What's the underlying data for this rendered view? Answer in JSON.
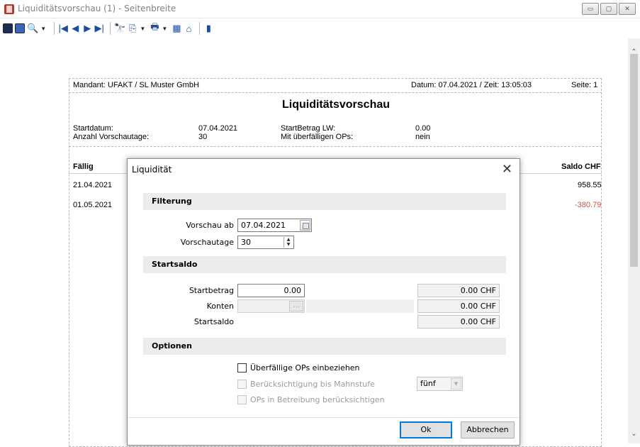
{
  "window": {
    "title": "Liquiditätsvorschau (1) - Seitenbreite",
    "minimize": "▭",
    "maximize": "▢",
    "close": "✕"
  },
  "toolbar": {
    "search_icon": "🔍",
    "dropdown_arrow": "▼",
    "first_page": "|◀",
    "prev_page": "◀",
    "next_page": "▶",
    "last_page": "▶|",
    "binoculars": "🔭",
    "export": "⎘",
    "print": "🖶",
    "excel": "▦",
    "settings": "⌂",
    "book": "▮"
  },
  "report": {
    "mandant": "Mandant: UFAKT / SL Muster GmbH",
    "datetime": "Datum: 07.04.2021 / Zeit: 13:05:03",
    "page": "Seite: 1",
    "title": "Liquiditätsvorschau",
    "startdatum_label": "Startdatum:",
    "startdatum_value": "07.04.2021",
    "vorschautage_label": "Anzahl Vorschautage:",
    "vorschautage_value": "30",
    "startbetrag_label": "StartBetrag LW:",
    "startbetrag_value": "0.00",
    "ueberfaellig_label": "Mit überfälligen OPs:",
    "ueberfaellig_value": "nein",
    "col_faellig": "Fällig",
    "col_saldo": "Saldo CHF",
    "rows": [
      {
        "date": "21.04.2021",
        "saldo": "958.55"
      },
      {
        "date": "01.05.2021",
        "saldo": "-380.79"
      }
    ]
  },
  "dialog": {
    "title": "Liquidität",
    "close": "✕",
    "section_filter": "Filterung",
    "vorschau_ab_label": "Vorschau ab",
    "vorschau_ab_value": "07.04.2021",
    "vorschautage_label": "Vorschautage",
    "vorschautage_value": "30",
    "section_startsaldo": "Startsaldo",
    "startbetrag_label": "Startbetrag",
    "startbetrag_value": "0.00",
    "startbetrag_chf": "0.00 CHF",
    "konten_label": "Konten",
    "konten_chf": "0.00 CHF",
    "startsaldo_label": "Startsaldo",
    "startsaldo_chf": "0.00 CHF",
    "section_optionen": "Optionen",
    "opt_ueberfaellig": "Überfällige OPs einbeziehen",
    "opt_mahnstufe": "Berücksichtigung bis Mahnstufe",
    "mahnstufe_value": "fünf",
    "opt_betreibung": "OPs in Betreibung berücksichtigen",
    "ok": "Ok",
    "cancel": "Abbrechen"
  }
}
